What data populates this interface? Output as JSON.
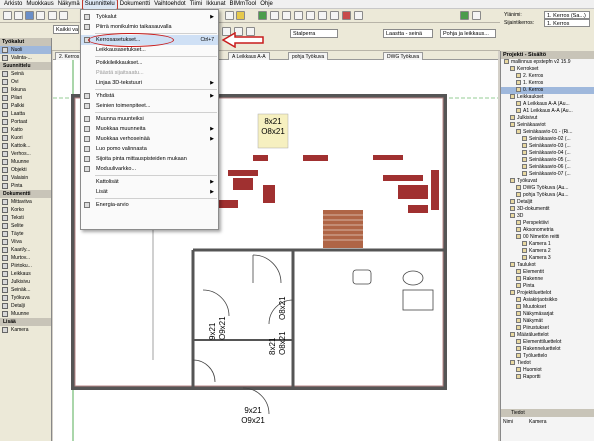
{
  "menubar": {
    "items": [
      "Arkisto",
      "Muokkaus",
      "Näkymä",
      "Suunnittelu",
      "Dokumentti",
      "Vaihtoehdot",
      "Tiimi",
      "Ikkunat",
      "BIMmTool",
      "Ohje"
    ],
    "active_index": 3
  },
  "toolbar": {
    "story_field": "Kaikki valittu: 1",
    "section_field": "Stalperra",
    "layer_field": "Laastta - seinä",
    "plan_field": "Pohja ja leikkaus...",
    "top_labels": [
      "Ylänimi:",
      "Sijaintikerros:"
    ],
    "top_values": [
      "1. Kerros (Sa...)",
      "1. Kerros"
    ]
  },
  "left_panel": {
    "title": "Työkalut",
    "items": [
      {
        "label": "Nuoli",
        "section": false,
        "selected": true
      },
      {
        "label": "Valinta-...",
        "section": false
      },
      {
        "label": "Suunnittelu",
        "section": true
      },
      {
        "label": "Seinä",
        "section": false
      },
      {
        "label": "Ovi",
        "section": false
      },
      {
        "label": "Ikkuna",
        "section": false
      },
      {
        "label": "Pilari",
        "section": false
      },
      {
        "label": "Palkki",
        "section": false
      },
      {
        "label": "Laatta",
        "section": false
      },
      {
        "label": "Portaat",
        "section": false
      },
      {
        "label": "Katto",
        "section": false
      },
      {
        "label": "Kuori",
        "section": false
      },
      {
        "label": "Kattoik...",
        "section": false
      },
      {
        "label": "Verhos...",
        "section": false
      },
      {
        "label": "Muunne",
        "section": false
      },
      {
        "label": "Objekti",
        "section": false
      },
      {
        "label": "Valaisin",
        "section": false
      },
      {
        "label": "Pinta",
        "section": false
      },
      {
        "label": "Dokumentti",
        "section": true
      },
      {
        "label": "Mittaviiva",
        "section": false
      },
      {
        "label": "Korko",
        "section": false
      },
      {
        "label": "Teksti",
        "section": false
      },
      {
        "label": "Selite",
        "section": false
      },
      {
        "label": "Täyte",
        "section": false
      },
      {
        "label": "Viiva",
        "section": false
      },
      {
        "label": "Kaari/y...",
        "section": false
      },
      {
        "label": "Murtov...",
        "section": false
      },
      {
        "label": "Piirtoku...",
        "section": false
      },
      {
        "label": "Leikkaus",
        "section": false
      },
      {
        "label": "Julkisivu",
        "section": false
      },
      {
        "label": "Seinäk...",
        "section": false
      },
      {
        "label": "Työkuva",
        "section": false
      },
      {
        "label": "Detalji",
        "section": false
      },
      {
        "label": "Muunne",
        "section": false
      },
      {
        "label": "Lisää",
        "section": true
      },
      {
        "label": "Kamera",
        "section": false
      }
    ]
  },
  "tabs": [
    "2. Kerros",
    "A Leikkaus A-A",
    "A Leikkaus A-A",
    "pohja Työkuva",
    "DWG Työkuva"
  ],
  "dropdown": {
    "items": [
      {
        "label": "Työkalut",
        "type": "sub",
        "icon": true
      },
      {
        "label": "Piirrä monikulmio taikasauvalla",
        "type": "item",
        "icon": true
      },
      {
        "label": "sep"
      },
      {
        "label": "Kerrosasetukset...",
        "type": "highlight",
        "shortcut": "Ctrl+7",
        "icon": true
      },
      {
        "label": "Leikkausasetukset...",
        "type": "item",
        "icon": false
      },
      {
        "label": "sep"
      },
      {
        "label": "Poikkileikkaukset...",
        "type": "item",
        "icon": false
      },
      {
        "label": "Päästä sijaitsaatu...",
        "type": "disabled",
        "icon": false
      },
      {
        "label": "Linjaa 3D-tekstuuri",
        "type": "sub",
        "icon": false
      },
      {
        "label": "sep"
      },
      {
        "label": "Yhdistä",
        "type": "sub",
        "icon": true
      },
      {
        "label": "Seinien toimenpiteet...",
        "type": "item",
        "icon": true
      },
      {
        "label": "sep"
      },
      {
        "label": "Muunna muunteiksi",
        "type": "item",
        "icon": true
      },
      {
        "label": "Muokkaa muunneita",
        "type": "sub",
        "icon": true
      },
      {
        "label": "Muokkaa verhoseinää",
        "type": "sub",
        "icon": true
      },
      {
        "label": "Luo pomo valinnasta",
        "type": "item",
        "icon": true
      },
      {
        "label": "Sijoita pinta mittauspisteiden mukaan",
        "type": "item",
        "icon": true
      },
      {
        "label": "Moduulivarkko...",
        "type": "item",
        "icon": true
      },
      {
        "label": "sep"
      },
      {
        "label": "Kattolisät",
        "type": "sub",
        "icon": false
      },
      {
        "label": "Lisät",
        "type": "sub",
        "icon": false
      },
      {
        "label": "sep"
      },
      {
        "label": "Energia-arvio",
        "type": "item",
        "icon": true
      }
    ]
  },
  "right_panel": {
    "title": "Projekti - Sisältö",
    "tree": [
      {
        "label": "mallinnus epstepfn v2 15.9",
        "indent": 0
      },
      {
        "label": "Kerrokset",
        "indent": 1
      },
      {
        "label": "2. Kerros",
        "indent": 2
      },
      {
        "label": "1. Kerros",
        "indent": 2
      },
      {
        "label": "0. Kerros",
        "indent": 2,
        "selected": true
      },
      {
        "label": "Leikkaukset",
        "indent": 1
      },
      {
        "label": "A Leikkaus A-A (Au...",
        "indent": 2
      },
      {
        "label": "A1 Leikkaus A-A (Au...",
        "indent": 2
      },
      {
        "label": "Julkisivut",
        "indent": 1
      },
      {
        "label": "Seinäkaaviot",
        "indent": 1
      },
      {
        "label": "Seinäkaavio-01 - (Ri...",
        "indent": 2
      },
      {
        "label": "Seinäkaavio-02 (...",
        "indent": 3
      },
      {
        "label": "Seinäkaavio-03 (...",
        "indent": 3
      },
      {
        "label": "Seinäkaavio-04 (...",
        "indent": 3
      },
      {
        "label": "Seinäkaavio-05 (...",
        "indent": 3
      },
      {
        "label": "Seinäkaavio-06 (...",
        "indent": 3
      },
      {
        "label": "Seinäkaavio-07 (...",
        "indent": 3
      },
      {
        "label": "Työkuvat",
        "indent": 1
      },
      {
        "label": "DWG Työkuva (Au...",
        "indent": 2
      },
      {
        "label": "pohja Työkuva (Au...",
        "indent": 2
      },
      {
        "label": "Detaljit",
        "indent": 1
      },
      {
        "label": "3D-dokumentit",
        "indent": 1
      },
      {
        "label": "3D",
        "indent": 1
      },
      {
        "label": "Perspektiivi",
        "indent": 2
      },
      {
        "label": "Aksonometria",
        "indent": 2
      },
      {
        "label": "00 Nimetön reitti",
        "indent": 2
      },
      {
        "label": "Kamera 1",
        "indent": 3
      },
      {
        "label": "Kamera 2",
        "indent": 3
      },
      {
        "label": "Kamera 3",
        "indent": 3
      },
      {
        "label": "Taulukot",
        "indent": 1
      },
      {
        "label": "Elementit",
        "indent": 2
      },
      {
        "label": "Rakenne",
        "indent": 2
      },
      {
        "label": "Pinta",
        "indent": 2
      },
      {
        "label": "Projektiluettelot",
        "indent": 1
      },
      {
        "label": "Asiakirjaotsikko",
        "indent": 2
      },
      {
        "label": "Muutokset",
        "indent": 2
      },
      {
        "label": "Näkymäsarjat",
        "indent": 2
      },
      {
        "label": "Näkymät",
        "indent": 2
      },
      {
        "label": "Piirustukset",
        "indent": 2
      },
      {
        "label": "Määräluettelot",
        "indent": 1
      },
      {
        "label": "Elementtiluettelot",
        "indent": 2
      },
      {
        "label": "Rakenneluettelot",
        "indent": 2
      },
      {
        "label": "Työluettelo",
        "indent": 2
      },
      {
        "label": "Tiedot",
        "indent": 1
      },
      {
        "label": "Huomiot",
        "indent": 2
      },
      {
        "label": "Raportti",
        "indent": 2
      }
    ],
    "footer_label": "Tiedot",
    "footer_col1": "Nimi",
    "footer_col2": "Kamera"
  },
  "plan_labels": {
    "door_a": "8x21",
    "door_a2": "O8x21",
    "door_b": "O8x21",
    "door_c": "9x21",
    "door_c2": "O9x21",
    "door_d": "8x21",
    "door_d2": "O8x21",
    "door_e": "9x21",
    "door_e2": "O9x21"
  },
  "colors": {
    "menu_highlight": "#cfe0f5",
    "annotation_red": "#c81c1c",
    "wall_red": "#a03030",
    "grid_green": "#2a9a2a"
  }
}
